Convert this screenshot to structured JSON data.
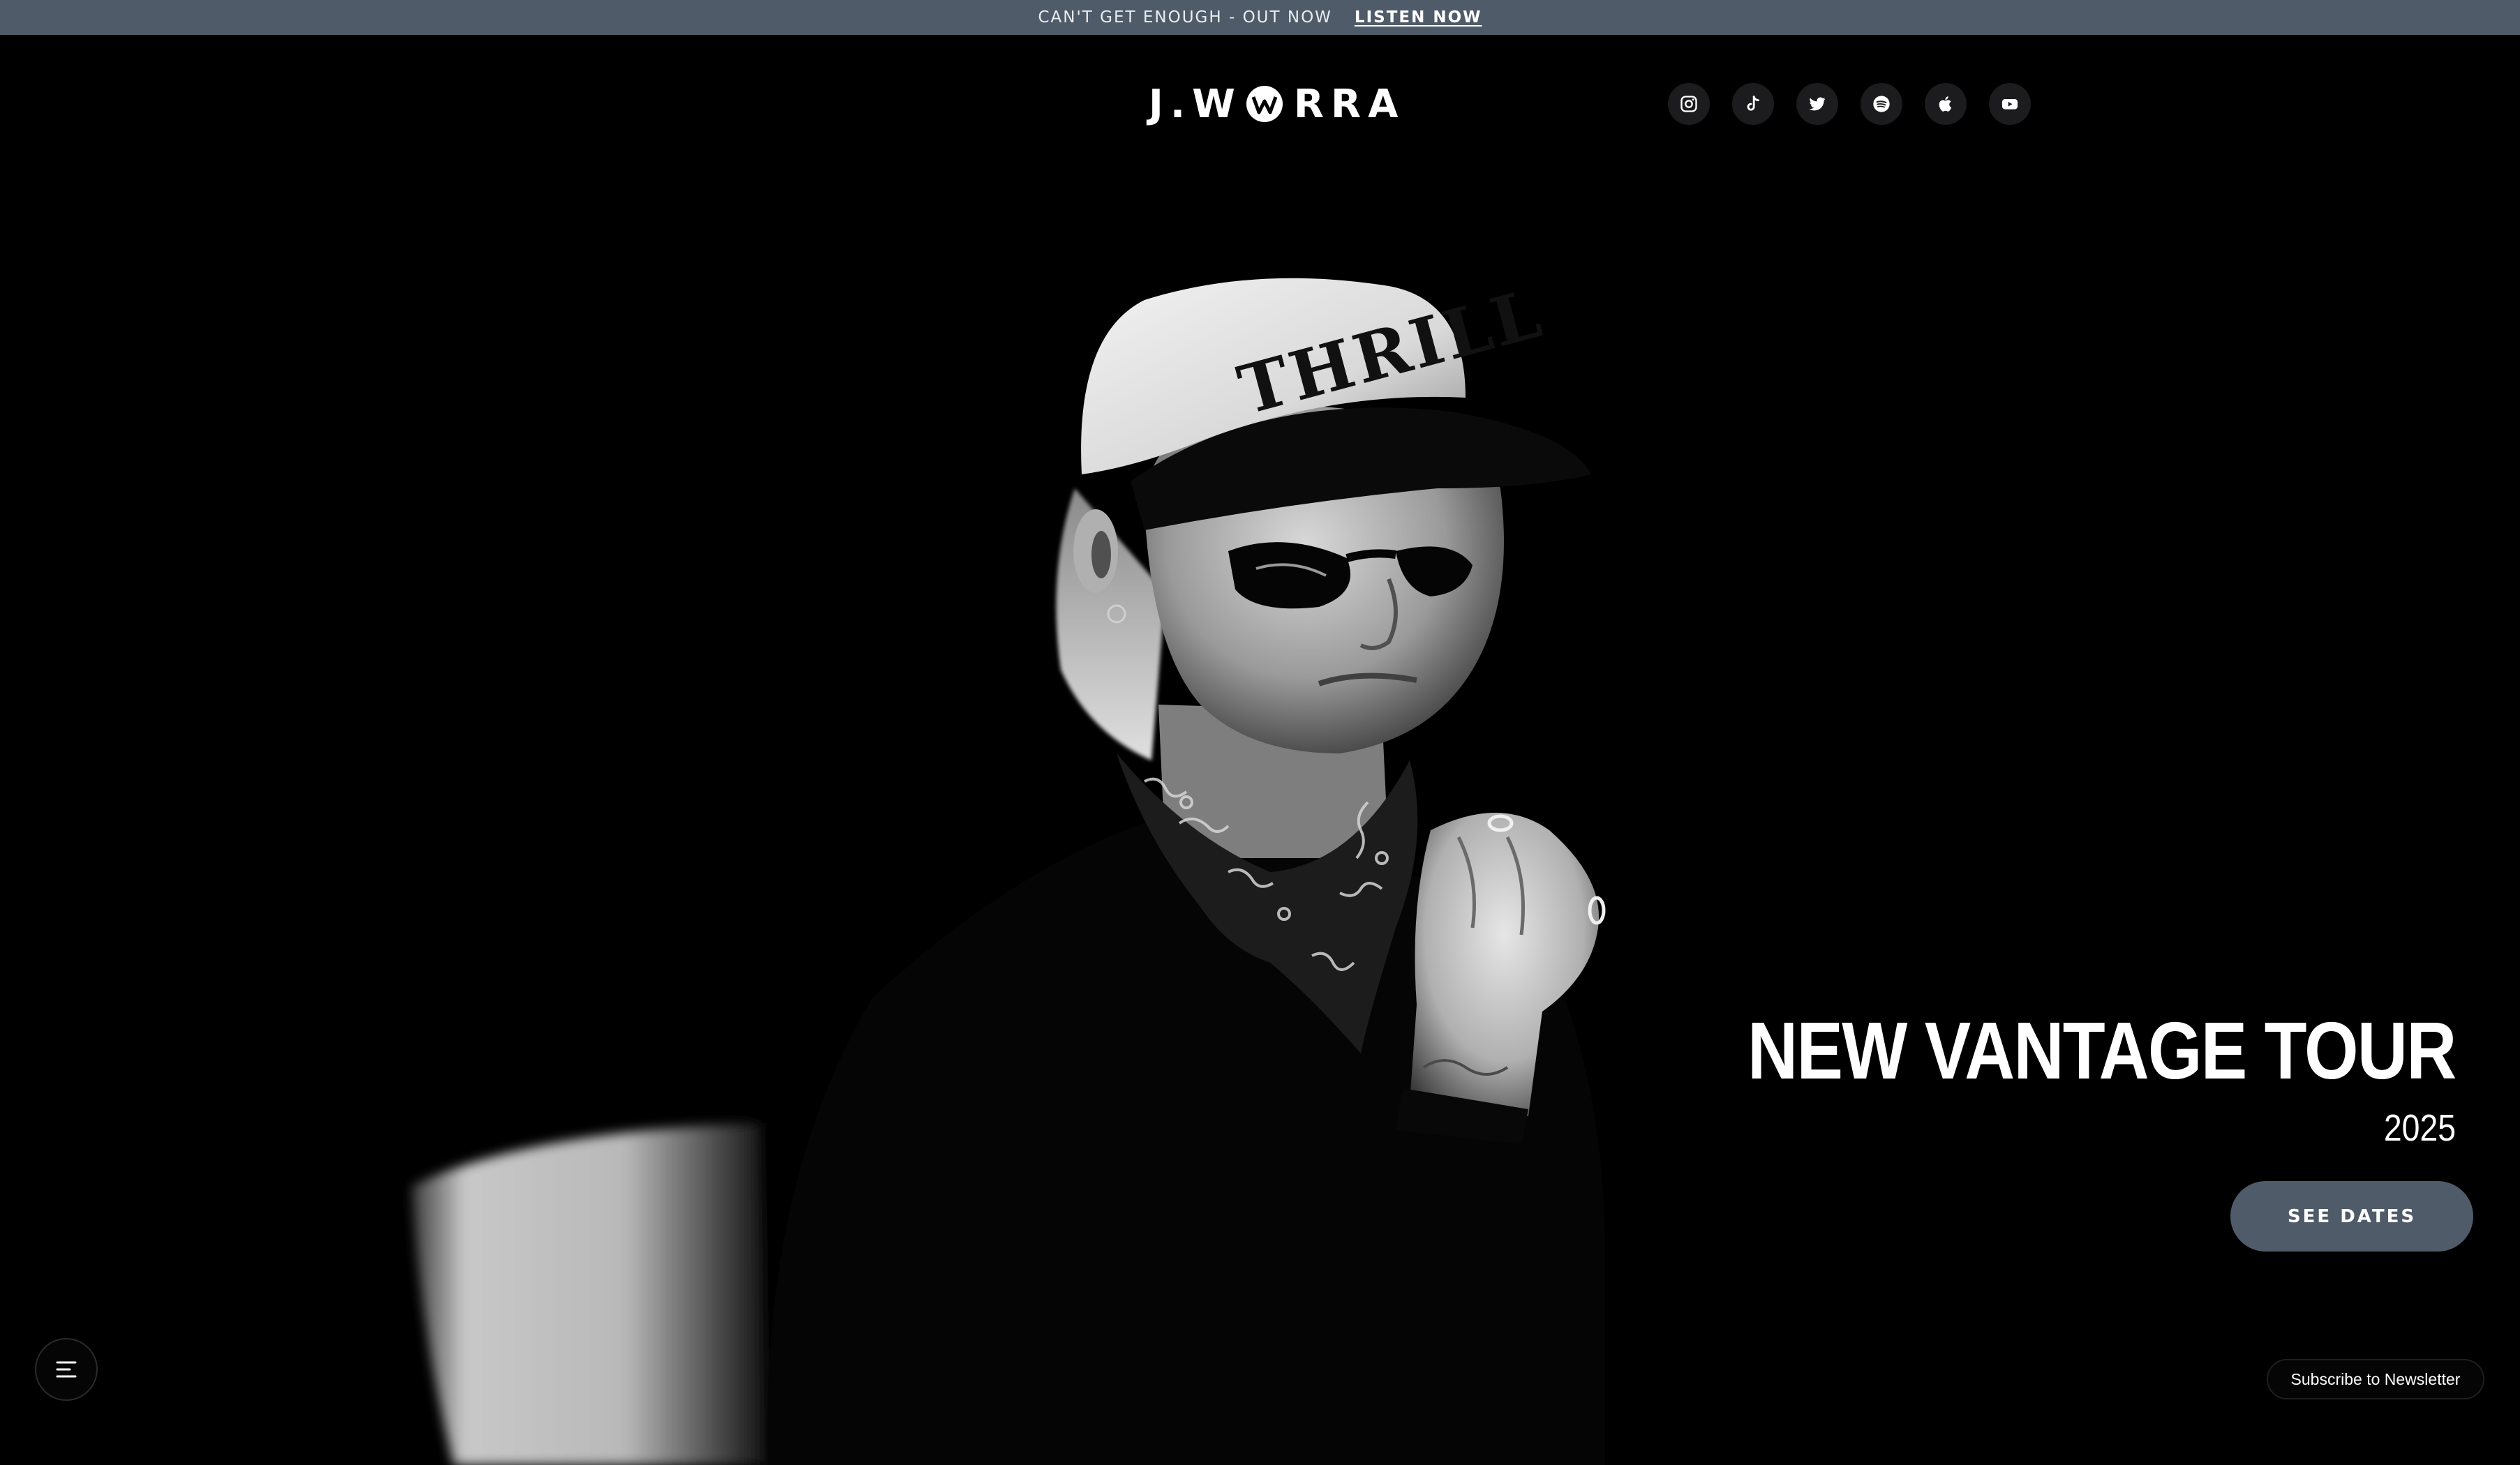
{
  "announcement": {
    "text": "CAN'T GET ENOUGH - OUT NOW",
    "link_label": "LISTEN NOW"
  },
  "header": {
    "logo_left": "J.W",
    "logo_right": "RRA",
    "logo_mark": "W"
  },
  "socials": [
    {
      "icon": "instagram-icon"
    },
    {
      "icon": "tiktok-icon"
    },
    {
      "icon": "twitter-icon"
    },
    {
      "icon": "spotify-icon"
    },
    {
      "icon": "apple-icon"
    },
    {
      "icon": "youtube-icon"
    }
  ],
  "hero": {
    "cap_text": "THRILL"
  },
  "tour": {
    "title": "NEW VANTAGE TOUR",
    "year": "2025",
    "button_label": "SEE DATES"
  },
  "newsletter": {
    "label": "Subscribe to Newsletter"
  },
  "colors": {
    "background": "#000000",
    "accent": "#4f5b69",
    "text": "#ffffff"
  }
}
